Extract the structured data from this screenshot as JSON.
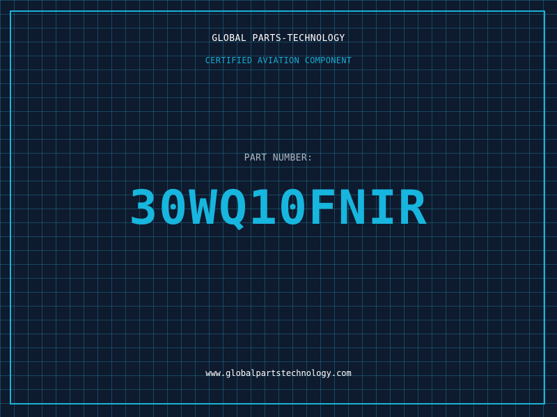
{
  "company": {
    "name": "GLOBAL PARTS-TECHNOLOGY",
    "tagline": "CERTIFIED AVIATION COMPONENT"
  },
  "part": {
    "label": "PART NUMBER:",
    "number": "30WQ10FNIR"
  },
  "footer": {
    "website": "www.globalpartstechnology.com"
  },
  "colors": {
    "background": "#0e1a2e",
    "grid": "#1e6e87",
    "accent": "#17b6de",
    "text": "#ffffff",
    "label": "#aeb8c4"
  }
}
